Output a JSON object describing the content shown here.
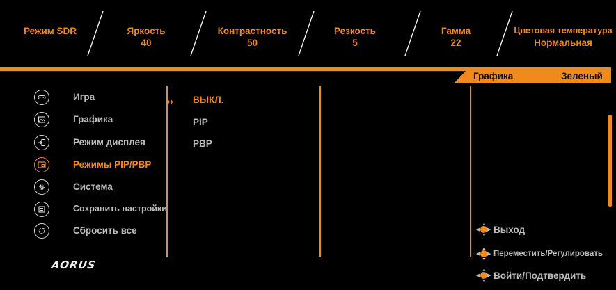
{
  "status_bar": [
    {
      "label": "Режим SDR",
      "value": ""
    },
    {
      "label": "Яркость",
      "value": "40"
    },
    {
      "label": "Контрастность",
      "value": "50"
    },
    {
      "label": "Резкость",
      "value": "5"
    },
    {
      "label": "Гамма",
      "value": "22"
    },
    {
      "label": "Цветовая температура",
      "value": "Нормальная"
    }
  ],
  "tabs": [
    "Графика",
    "Зеленый"
  ],
  "menu": [
    {
      "label": "Игра",
      "icon": "gamepad-icon"
    },
    {
      "label": "Графика",
      "icon": "picture-icon"
    },
    {
      "label": "Режим дисплея",
      "icon": "input-icon"
    },
    {
      "label": "Режимы PIP/PBP",
      "icon": "pip-icon",
      "active": true
    },
    {
      "label": "Система",
      "icon": "gear-icon"
    },
    {
      "label": "Сохранить настройки",
      "icon": "save-icon"
    },
    {
      "label": "Сбросить все",
      "icon": "reset-icon"
    }
  ],
  "submenu": [
    {
      "label": "ВЫКЛ.",
      "active": true
    },
    {
      "label": "PIP"
    },
    {
      "label": "PBP"
    }
  ],
  "logo": "AORUS",
  "help": [
    {
      "label": "Выход",
      "icon": "joystick-icon"
    },
    {
      "label": "Переместить/Регулировать",
      "icon": "joystick-icon"
    },
    {
      "label": "Войти/Подтвердить",
      "icon": "joystick-icon"
    }
  ],
  "colors": {
    "accent": "#f08a1c",
    "background": "#000000",
    "text": "#bdbdbd"
  }
}
